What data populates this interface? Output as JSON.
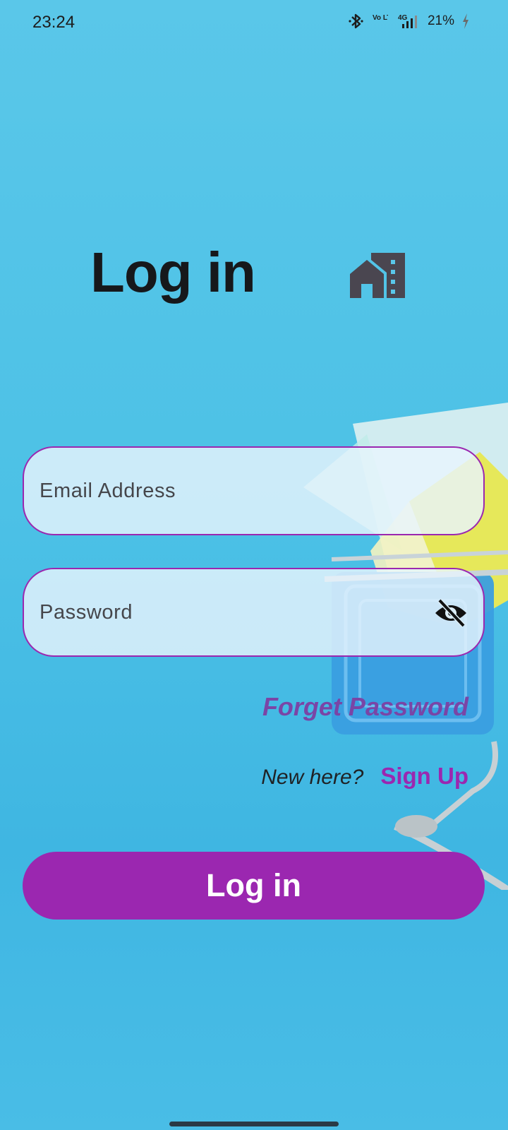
{
  "status_bar": {
    "time": "23:24",
    "battery": "21%",
    "icons": [
      "bluetooth-icon",
      "volte-icon",
      "signal-4g-icon",
      "battery-charging-icon"
    ],
    "volte_label": "Vo LTE",
    "network_label": "4G"
  },
  "header": {
    "title": "Log in",
    "logo_icon": "home-building-icon"
  },
  "form": {
    "email_placeholder": "Email Address",
    "password_placeholder": "Password",
    "password_toggle_icon": "eye-off-icon",
    "forget_password_label": "Forget Password",
    "signup_prompt": "New here?",
    "signup_label": "Sign Up",
    "login_button_label": "Log in"
  },
  "colors": {
    "accent": "#9b27b0",
    "forget_link": "#7a45a6",
    "background": "#4cc1e6",
    "field_fill": "#e8f4fc"
  }
}
